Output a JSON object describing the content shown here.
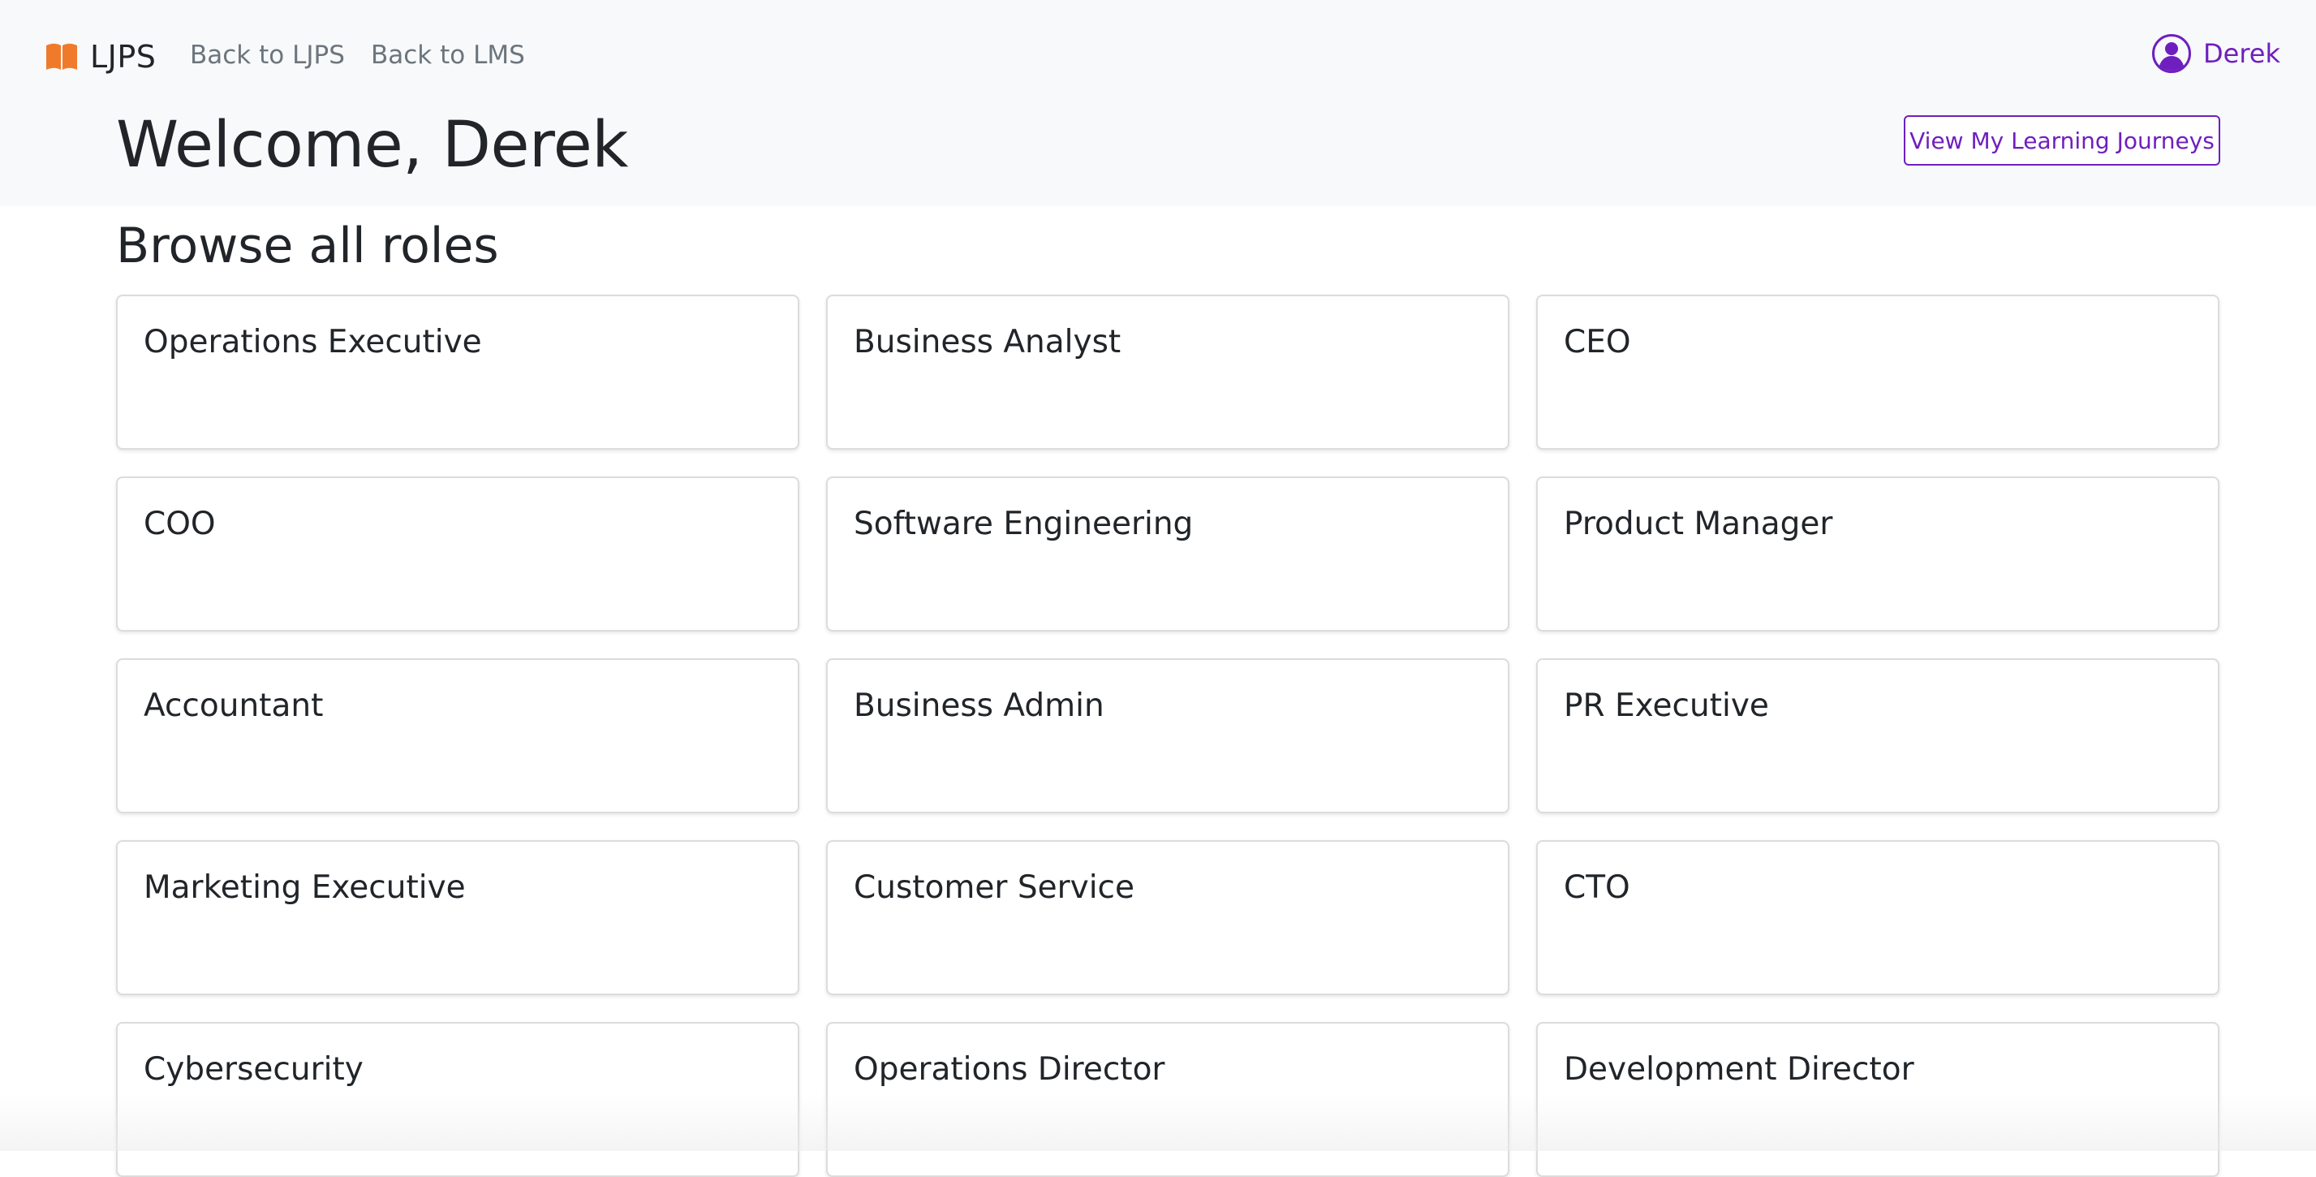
{
  "nav": {
    "brand": "LJPS",
    "brand_icon": "book-icon",
    "brand_icon_color": "#f07a2c",
    "links": [
      "Back to LJPS",
      "Back to LMS"
    ],
    "user_name": "Derek",
    "user_icon": "user-circle-icon",
    "accent_color": "#6f1fbf"
  },
  "header": {
    "welcome": "Welcome, Derek",
    "journeys_button": "View My Learning Journeys"
  },
  "main": {
    "section_title": "Browse all roles",
    "roles": [
      "Operations Executive",
      "Business Analyst",
      "CEO",
      "COO",
      "Software Engineering",
      "Product Manager",
      "Accountant",
      "Business Admin",
      "PR Executive",
      "Marketing Executive",
      "Customer Service",
      "CTO",
      "Cybersecurity",
      "Operations Director",
      "Development Director"
    ]
  }
}
